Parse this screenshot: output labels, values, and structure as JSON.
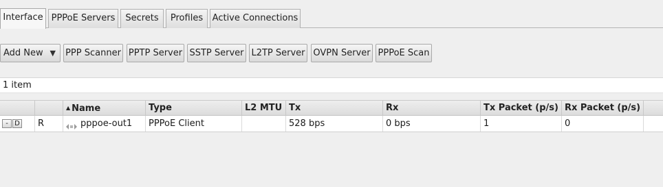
{
  "tabs": [
    {
      "label": "Interface",
      "active": true
    },
    {
      "label": "PPPoE Servers",
      "active": false
    },
    {
      "label": "Secrets",
      "active": false
    },
    {
      "label": "Profiles",
      "active": false
    },
    {
      "label": "Active Connections",
      "active": false
    }
  ],
  "toolbar": {
    "add_new": "Add New",
    "caret": "▼",
    "buttons": [
      "PPP Scanner",
      "PPTP Server",
      "SSTP Server",
      "L2TP Server",
      "OVPN Server",
      "PPPoE Scan"
    ]
  },
  "item_count": "1 item",
  "table": {
    "sort_indicator": "▲",
    "columns": [
      "",
      "",
      "Name",
      "Type",
      "L2 MTU",
      "Tx",
      "Rx",
      "Tx Packet (p/s)",
      "Rx Packet (p/s)"
    ],
    "rows": [
      {
        "row_buttons": [
          "-",
          "D"
        ],
        "flags": "R",
        "name": "pppoe-out1",
        "icon": "interface-icon",
        "type": "PPPoE Client",
        "l2mtu": "",
        "tx": "528 bps",
        "rx": "0 bps",
        "tx_pps": "1",
        "rx_pps": "0"
      }
    ]
  }
}
